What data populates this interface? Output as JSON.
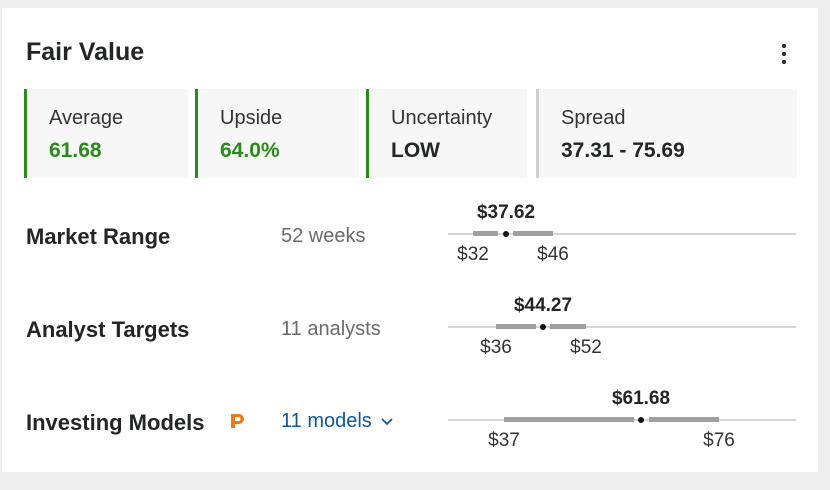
{
  "title": "Fair Value",
  "stats": [
    {
      "label": "Average",
      "value": "61.68",
      "color": "#2a8a1a"
    },
    {
      "label": "Upside",
      "value": "64.0%",
      "color": "#2a8a1a"
    },
    {
      "label": "Uncertainty",
      "value": "LOW",
      "color": "#232526"
    },
    {
      "label": "Spread",
      "value": "37.31 - 75.69",
      "color": "#232526"
    }
  ],
  "rows": {
    "market_range": {
      "label": "Market Range",
      "sub": "52 weeks",
      "current": "$37.62",
      "low": "$32",
      "high": "$46"
    },
    "analyst_targets": {
      "label": "Analyst Targets",
      "sub": "11 analysts",
      "current": "$44.27",
      "low": "$36",
      "high": "$52"
    },
    "investing_models": {
      "label": "Investing Models",
      "link": "11 models",
      "current": "$61.68",
      "low": "$37",
      "high": "$76"
    }
  },
  "colors": {
    "accent_green": "#2a8a1a",
    "pro_orange": "#f07a1a",
    "link_blue": "#1256a0"
  },
  "icons": {
    "menu": "kebab-menu-icon",
    "pro": "pro-badge-icon",
    "expand": "chevron-down-icon"
  }
}
